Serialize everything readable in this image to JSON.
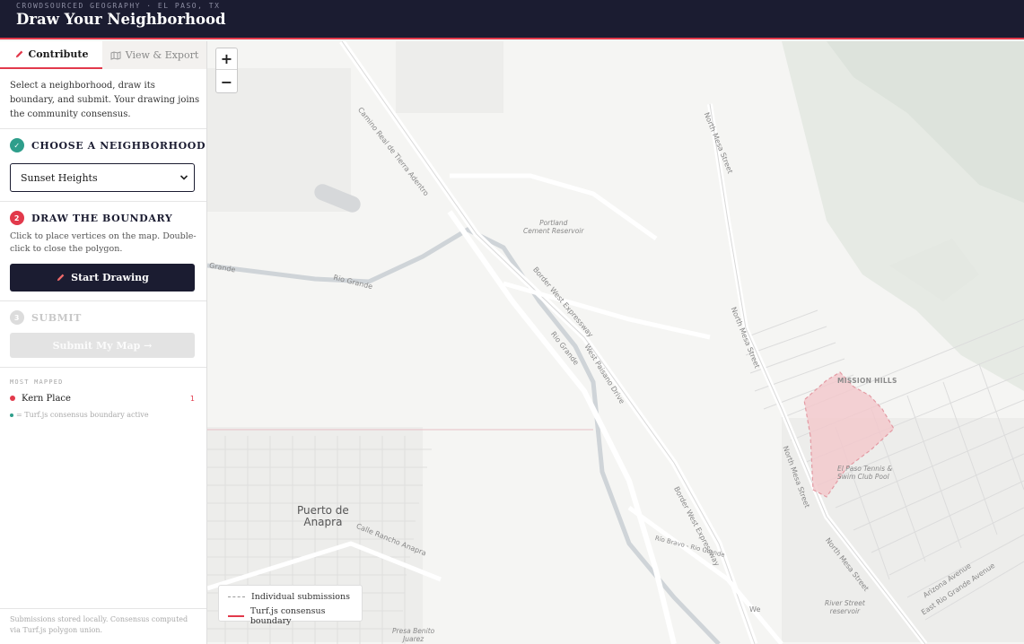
{
  "header": {
    "kicker": "CROWDSOURCED GEOGRAPHY · EL PASO, TX",
    "title": "Draw Your Neighborhood"
  },
  "tabs": [
    {
      "label": "Contribute",
      "icon": "pencil-icon",
      "active": true
    },
    {
      "label": "View & Export",
      "icon": "map-icon",
      "active": false
    }
  ],
  "intro": "Select a neighborhood, draw its boundary, and submit. Your drawing joins the community consensus.",
  "steps": {
    "choose": {
      "number": "✓",
      "title": "CHOOSE A NEIGHBORHOOD",
      "status": "done"
    },
    "draw": {
      "number": "2",
      "title": "DRAW THE BOUNDARY",
      "status": "active",
      "hint": "Click to place vertices on the map. Double-click to close the polygon."
    },
    "submit": {
      "number": "3",
      "title": "SUBMIT",
      "status": "disabled"
    }
  },
  "neighborhood_select": {
    "value": "Sunset Heights"
  },
  "buttons": {
    "start_drawing": "Start Drawing",
    "submit_map": "Submit My Map →"
  },
  "most_mapped": {
    "label": "MOST MAPPED",
    "items": [
      {
        "name": "Kern Place",
        "count": "1"
      }
    ],
    "note": "= Turf.js consensus boundary active"
  },
  "footer": "Submissions stored locally. Consensus computed via Turf.js polygon union.",
  "map": {
    "zoom_in": "+",
    "zoom_out": "−",
    "labels": {
      "camino_real": "Camino Real de Tierra Adentro",
      "north_mesa_top": "North Mesa Street",
      "portland_reservoir": "Portland\nCement Reservoir",
      "rio_grande_left": "Grande",
      "rio_grande_mid": "Rio Grande",
      "border_west_1": "Border West Expressway",
      "rio_grande_river": "Rio Grande",
      "west_paisano": "West Paisano Drive",
      "north_mesa_mid": "North Mesa Street",
      "mission_hills": "MISSION HILLS",
      "el_paso_tennis": "El Paso Tennis &\nSwim Club Pool",
      "north_mesa_low": "North Mesa Street",
      "puerto_de_anapra": "Puerto de\nAnapra",
      "calle_rancho": "Calle Rancho Anapra",
      "border_west_2": "Border West Expressway",
      "rio_bravo": "Río Bravo - Rio Grande",
      "north_mesa_bottom": "North Mesa Street",
      "arizona_ave": "Arizona Avenue",
      "east_rio_grande": "East Rio Grande Avenue",
      "river_street": "River Street\nreservoir",
      "presa_benito": "Presa Benito\nJuarez",
      "we_label": "We"
    },
    "legend": {
      "individual": "Individual submissions",
      "consensus": "Turf.js consensus boundary"
    },
    "colors": {
      "accent": "#e2394b",
      "header_bg": "#1b1c31",
      "done_green": "#2e9e8b",
      "consensus_fill": "#f2c9cd"
    }
  }
}
